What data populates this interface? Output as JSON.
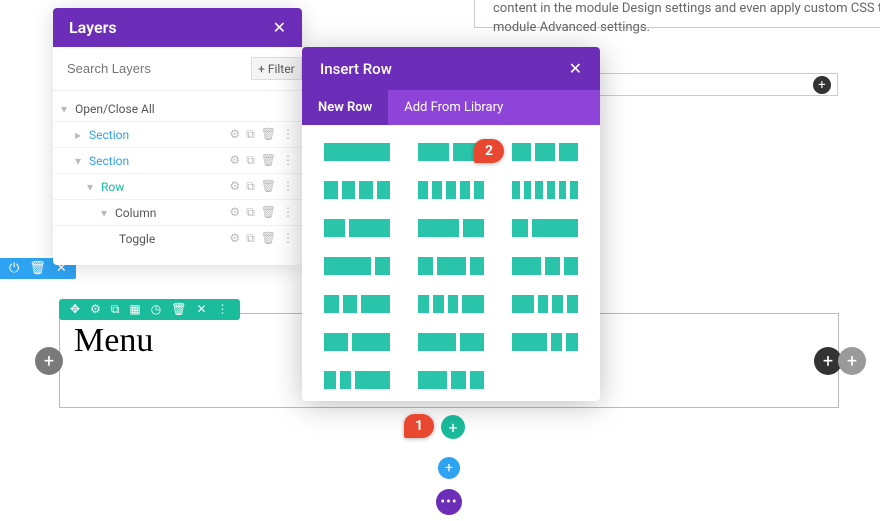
{
  "descText": "content in the module Design settings and even apply custom CSS to this text in the module Advanced settings.",
  "layers": {
    "title": "Layers",
    "searchPlaceholder": "Search Layers",
    "filterLabel": "Filter",
    "openCloseAll": "Open/Close All",
    "tree": {
      "section1": "Section",
      "section2": "Section",
      "row": "Row",
      "column": "Column",
      "toggle": "Toggle"
    }
  },
  "insertRow": {
    "title": "Insert Row",
    "tabNewRow": "New Row",
    "tabLibrary": "Add From Library"
  },
  "menu": {
    "label": "Menu"
  },
  "markers": {
    "m1": "1",
    "m2": "2"
  },
  "icons": {
    "close": "✕",
    "plus": "+",
    "dots": "•••",
    "gear": "⚙",
    "dup": "⧉",
    "trash": "🗑",
    "more": "⋮",
    "power": "⏻",
    "caretDown": "▾",
    "caretRight": "▸",
    "cross": "✕",
    "move": "✥",
    "cols": "▦",
    "clock": "◷",
    "filter": "+"
  }
}
